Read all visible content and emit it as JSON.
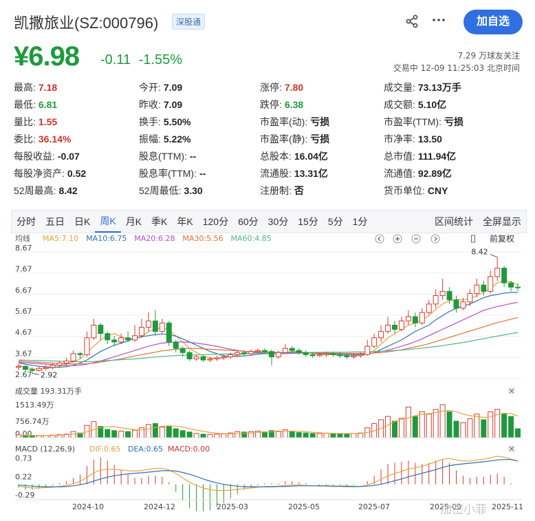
{
  "header": {
    "title": "凯撒旅业(SZ:000796)",
    "tag": "深股通",
    "follow_button": "加自选",
    "share_icon": "share-icon",
    "more_icon": "more-icon"
  },
  "quote": {
    "price": "¥6.98",
    "change": "-0.11",
    "change_pct": "-1.55%",
    "followers": "7.29 万球友关注",
    "status_time": "交易中 12-09 11:25:03 北京时间",
    "price_color": "#1d9a3c"
  },
  "stats": [
    {
      "k": "最高:",
      "v": "7.18",
      "c": "red"
    },
    {
      "k": "今开:",
      "v": "7.09",
      "c": "dark"
    },
    {
      "k": "涨停:",
      "v": "7.80",
      "c": "red"
    },
    {
      "k": "成交量:",
      "v": "73.13万手",
      "c": "dark"
    },
    {
      "k": "最低:",
      "v": "6.81",
      "c": "green"
    },
    {
      "k": "昨收:",
      "v": "7.09",
      "c": "dark"
    },
    {
      "k": "跌停:",
      "v": "6.38",
      "c": "green"
    },
    {
      "k": "成交额:",
      "v": "5.10亿",
      "c": "dark"
    },
    {
      "k": "量比:",
      "v": "1.55",
      "c": "red"
    },
    {
      "k": "换手:",
      "v": "5.50%",
      "c": "dark"
    },
    {
      "k": "市盈率(动):",
      "v": "亏损",
      "c": "dark"
    },
    {
      "k": "市盈率(TTM):",
      "v": "亏损",
      "c": "dark"
    },
    {
      "k": "委比:",
      "v": "36.14%",
      "c": "red"
    },
    {
      "k": "振幅:",
      "v": "5.22%",
      "c": "dark"
    },
    {
      "k": "市盈率(静):",
      "v": "亏损",
      "c": "dark"
    },
    {
      "k": "市净率:",
      "v": "13.50",
      "c": "dark"
    },
    {
      "k": "每股收益:",
      "v": "-0.07",
      "c": "dark"
    },
    {
      "k": "股息(TTM):",
      "v": "--",
      "c": "dark"
    },
    {
      "k": "总股本:",
      "v": "16.04亿",
      "c": "dark"
    },
    {
      "k": "总市值:",
      "v": "111.94亿",
      "c": "dark"
    },
    {
      "k": "每股净资产:",
      "v": "0.52",
      "c": "dark"
    },
    {
      "k": "股息率(TTM):",
      "v": "--",
      "c": "dark"
    },
    {
      "k": "流通股:",
      "v": "13.31亿",
      "c": "dark"
    },
    {
      "k": "流通值:",
      "v": "92.89亿",
      "c": "dark"
    },
    {
      "k": "52周最高:",
      "v": "8.42",
      "c": "dark"
    },
    {
      "k": "52周最低:",
      "v": "3.30",
      "c": "dark"
    },
    {
      "k": "注册制:",
      "v": "否",
      "c": "dark"
    },
    {
      "k": "货币单位:",
      "v": "CNY",
      "c": "dark"
    }
  ],
  "tabs": [
    "分时",
    "五日",
    "日K",
    "周K",
    "月K",
    "季K",
    "年K",
    "120分",
    "60分",
    "30分",
    "15分",
    "5分",
    "1分"
  ],
  "active_tab": "周K",
  "tabs_right": [
    "区间统计",
    "全屏显示"
  ],
  "chart_data": {
    "type": "candlestick",
    "kline": {
      "label": "均线",
      "ma_labels": [
        {
          "text": "MA5:7.10",
          "color": "#e6a23c"
        },
        {
          "text": "MA10:6.75",
          "color": "#2f6fb0"
        },
        {
          "text": "MA20:6.28",
          "color": "#b44fc6"
        },
        {
          "text": "MA30:5.56",
          "color": "#e0703a"
        },
        {
          "text": "MA60:4.85",
          "color": "#4fb58a"
        }
      ],
      "y_ticks": [
        "8.67",
        "7.67",
        "6.67",
        "5.67",
        "4.67",
        "3.67",
        "2.67"
      ],
      "ylim": [
        2.67,
        8.67
      ],
      "max_label": "8.42",
      "min_label": "2.92",
      "fq_label": "前复权",
      "toolbar_icons": [
        "chevron-left-icon",
        "plus-icon",
        "minus-icon",
        "chevron-right-icon",
        "candle-icon"
      ]
    },
    "candles": [
      [
        3.2,
        3.25,
        3.05,
        3.35
      ],
      [
        3.25,
        3.1,
        3.0,
        3.3
      ],
      [
        3.1,
        3.05,
        2.92,
        3.2
      ],
      [
        3.05,
        3.15,
        3.0,
        3.25
      ],
      [
        3.15,
        3.2,
        3.05,
        3.3
      ],
      [
        3.2,
        3.3,
        3.1,
        3.4
      ],
      [
        3.3,
        3.4,
        3.2,
        3.5
      ],
      [
        3.4,
        3.5,
        3.3,
        3.65
      ],
      [
        3.5,
        3.85,
        3.45,
        4.0
      ],
      [
        3.85,
        3.8,
        3.6,
        3.95
      ],
      [
        3.8,
        4.6,
        3.7,
        4.9
      ],
      [
        4.6,
        5.2,
        4.5,
        5.5
      ],
      [
        5.2,
        4.8,
        4.5,
        5.3
      ],
      [
        4.8,
        4.5,
        4.3,
        4.9
      ],
      [
        4.5,
        4.4,
        4.2,
        4.7
      ],
      [
        4.4,
        4.6,
        4.3,
        4.8
      ],
      [
        4.6,
        4.5,
        4.4,
        4.9
      ],
      [
        4.5,
        4.7,
        4.4,
        5.2
      ],
      [
        4.7,
        5.1,
        4.6,
        5.5
      ],
      [
        5.1,
        5.4,
        4.9,
        5.8
      ],
      [
        5.4,
        4.9,
        4.7,
        5.9
      ],
      [
        4.9,
        5.3,
        4.8,
        5.5
      ],
      [
        5.3,
        4.4,
        4.2,
        5.4
      ],
      [
        4.4,
        4.1,
        3.9,
        4.5
      ],
      [
        4.1,
        3.9,
        3.7,
        4.2
      ],
      [
        3.9,
        3.6,
        3.5,
        4.0
      ],
      [
        3.6,
        3.7,
        3.5,
        3.8
      ],
      [
        3.7,
        3.55,
        3.45,
        3.75
      ],
      [
        3.55,
        3.6,
        3.45,
        3.7
      ],
      [
        3.6,
        3.65,
        3.5,
        3.75
      ],
      [
        3.65,
        3.7,
        3.55,
        3.8
      ],
      [
        3.7,
        3.8,
        3.6,
        3.9
      ],
      [
        3.8,
        3.9,
        3.7,
        4.0
      ],
      [
        3.9,
        3.85,
        3.75,
        4.0
      ],
      [
        3.85,
        3.95,
        3.8,
        4.05
      ],
      [
        3.95,
        4.0,
        3.85,
        4.1
      ],
      [
        4.0,
        3.95,
        3.85,
        4.1
      ],
      [
        3.95,
        3.7,
        3.3,
        4.05
      ],
      [
        3.7,
        3.9,
        3.6,
        4.0
      ],
      [
        3.9,
        4.1,
        3.85,
        4.3
      ],
      [
        4.1,
        4.0,
        3.9,
        4.2
      ],
      [
        4.0,
        3.9,
        3.8,
        4.1
      ],
      [
        3.9,
        3.8,
        3.7,
        4.0
      ],
      [
        3.8,
        3.75,
        3.65,
        3.9
      ],
      [
        3.75,
        3.8,
        3.7,
        3.9
      ],
      [
        3.8,
        3.85,
        3.7,
        3.95
      ],
      [
        3.85,
        3.8,
        3.7,
        3.95
      ],
      [
        3.8,
        3.75,
        3.65,
        3.9
      ],
      [
        3.75,
        3.7,
        3.6,
        3.85
      ],
      [
        3.7,
        3.75,
        3.6,
        3.85
      ],
      [
        3.75,
        3.8,
        3.65,
        3.9
      ],
      [
        3.8,
        4.2,
        3.75,
        4.5
      ],
      [
        4.2,
        4.6,
        4.1,
        4.8
      ],
      [
        4.6,
        4.9,
        4.4,
        5.2
      ],
      [
        4.9,
        5.2,
        4.8,
        5.6
      ],
      [
        5.2,
        5.0,
        4.8,
        5.4
      ],
      [
        5.0,
        5.4,
        4.9,
        5.6
      ],
      [
        5.4,
        5.6,
        5.2,
        5.9
      ],
      [
        5.6,
        5.3,
        5.1,
        5.8
      ],
      [
        5.3,
        5.8,
        5.2,
        6.0
      ],
      [
        5.8,
        6.2,
        5.7,
        6.4
      ],
      [
        6.2,
        6.6,
        6.0,
        6.9
      ],
      [
        6.6,
        6.8,
        6.4,
        7.4
      ],
      [
        6.8,
        6.4,
        6.2,
        7.0
      ],
      [
        6.4,
        6.0,
        5.8,
        6.6
      ],
      [
        6.0,
        6.3,
        5.9,
        6.5
      ],
      [
        6.3,
        6.7,
        6.1,
        6.9
      ],
      [
        6.7,
        7.1,
        6.5,
        7.4
      ],
      [
        7.1,
        6.8,
        6.6,
        7.3
      ],
      [
        6.8,
        7.5,
        6.7,
        7.8
      ],
      [
        7.5,
        7.9,
        7.3,
        8.42
      ],
      [
        7.9,
        7.2,
        7.0,
        8.0
      ],
      [
        7.2,
        7.0,
        6.8,
        7.3
      ],
      [
        7.0,
        6.98,
        6.81,
        7.18
      ]
    ],
    "ma_series": [
      {
        "name": "MA5",
        "color": "#e6a23c",
        "values": [
          3.3,
          3.2,
          3.12,
          3.12,
          3.15,
          3.18,
          3.25,
          3.35,
          3.45,
          3.6,
          3.9,
          4.2,
          4.5,
          4.7,
          4.8,
          4.65,
          4.55,
          4.55,
          4.65,
          4.9,
          5.0,
          5.1,
          4.95,
          4.7,
          4.4,
          4.1,
          3.9,
          3.75,
          3.65,
          3.6,
          3.65,
          3.7,
          3.78,
          3.82,
          3.87,
          3.92,
          3.95,
          3.88,
          3.85,
          3.9,
          3.95,
          3.95,
          3.9,
          3.85,
          3.82,
          3.8,
          3.8,
          3.78,
          3.76,
          3.75,
          3.76,
          3.85,
          4.0,
          4.3,
          4.6,
          4.8,
          5.0,
          5.2,
          5.3,
          5.45,
          5.65,
          5.95,
          6.2,
          6.35,
          6.4,
          6.4,
          6.45,
          6.6,
          6.75,
          6.95,
          7.2,
          7.3,
          7.25,
          7.1
        ]
      },
      {
        "name": "MA10",
        "color": "#2f6fb0",
        "values": [
          3.4,
          3.35,
          3.3,
          3.25,
          3.22,
          3.2,
          3.2,
          3.23,
          3.3,
          3.4,
          3.55,
          3.75,
          3.95,
          4.1,
          4.25,
          4.35,
          4.45,
          4.6,
          4.65,
          4.7,
          4.75,
          4.78,
          4.75,
          4.68,
          4.55,
          4.4,
          4.25,
          4.1,
          3.95,
          3.85,
          3.75,
          3.72,
          3.72,
          3.74,
          3.78,
          3.82,
          3.85,
          3.85,
          3.87,
          3.9,
          3.92,
          3.92,
          3.9,
          3.88,
          3.86,
          3.84,
          3.82,
          3.8,
          3.8,
          3.8,
          3.8,
          3.82,
          3.9,
          4.05,
          4.2,
          4.35,
          4.5,
          4.7,
          4.9,
          5.05,
          5.2,
          5.45,
          5.65,
          5.85,
          6.0,
          6.1,
          6.2,
          6.35,
          6.5,
          6.6,
          6.65,
          6.72,
          6.75,
          6.75
        ]
      },
      {
        "name": "MA20",
        "color": "#b44fc6",
        "values": [
          3.45,
          3.42,
          3.4,
          3.37,
          3.35,
          3.32,
          3.3,
          3.28,
          3.28,
          3.3,
          3.35,
          3.42,
          3.5,
          3.6,
          3.7,
          3.8,
          3.9,
          4.0,
          4.1,
          4.2,
          4.28,
          4.35,
          4.38,
          4.4,
          4.4,
          4.38,
          4.35,
          4.3,
          4.25,
          4.2,
          4.12,
          4.06,
          4.0,
          3.96,
          3.93,
          3.9,
          3.88,
          3.86,
          3.85,
          3.85,
          3.86,
          3.87,
          3.88,
          3.88,
          3.87,
          3.86,
          3.86,
          3.85,
          3.85,
          3.85,
          3.85,
          3.86,
          3.88,
          3.95,
          4.02,
          4.1,
          4.2,
          4.3,
          4.42,
          4.55,
          4.7,
          4.85,
          5.0,
          5.15,
          5.3,
          5.45,
          5.6,
          5.75,
          5.9,
          6.0,
          6.08,
          6.15,
          6.22,
          6.28
        ]
      },
      {
        "name": "MA30",
        "color": "#e0703a",
        "values": [
          3.5,
          3.48,
          3.46,
          3.44,
          3.42,
          3.4,
          3.38,
          3.37,
          3.36,
          3.36,
          3.37,
          3.4,
          3.45,
          3.5,
          3.55,
          3.6,
          3.67,
          3.74,
          3.8,
          3.86,
          3.92,
          3.98,
          4.02,
          4.06,
          4.08,
          4.1,
          4.1,
          4.08,
          4.06,
          4.04,
          4.02,
          4.0,
          3.98,
          3.96,
          3.95,
          3.94,
          3.93,
          3.92,
          3.91,
          3.9,
          3.9,
          3.89,
          3.89,
          3.88,
          3.88,
          3.87,
          3.87,
          3.87,
          3.86,
          3.86,
          3.86,
          3.87,
          3.88,
          3.9,
          3.94,
          3.98,
          4.03,
          4.1,
          4.17,
          4.24,
          4.32,
          4.42,
          4.52,
          4.62,
          4.72,
          4.82,
          4.92,
          5.02,
          5.12,
          5.22,
          5.32,
          5.4,
          5.48,
          5.56
        ]
      },
      {
        "name": "MA60",
        "color": "#4fb58a",
        "values": [
          3.55,
          3.54,
          3.53,
          3.52,
          3.51,
          3.5,
          3.49,
          3.48,
          3.47,
          3.47,
          3.47,
          3.48,
          3.5,
          3.52,
          3.54,
          3.56,
          3.58,
          3.6,
          3.63,
          3.66,
          3.69,
          3.72,
          3.74,
          3.76,
          3.77,
          3.78,
          3.79,
          3.8,
          3.81,
          3.82,
          3.83,
          3.84,
          3.85,
          3.86,
          3.87,
          3.87,
          3.88,
          3.88,
          3.89,
          3.89,
          3.9,
          3.9,
          3.9,
          3.91,
          3.91,
          3.91,
          3.92,
          3.92,
          3.92,
          3.93,
          3.93,
          3.94,
          3.95,
          3.96,
          3.98,
          4.0,
          4.02,
          4.05,
          4.08,
          4.11,
          4.15,
          4.19,
          4.23,
          4.28,
          4.33,
          4.38,
          4.43,
          4.5,
          4.56,
          4.62,
          4.68,
          4.74,
          4.8,
          4.85
        ]
      }
    ],
    "volume": {
      "label": "成交量 193.31万手",
      "y_ticks": [
        "1513.49万",
        "756.74万",
        "0.00"
      ],
      "max": 1513.49,
      "values": [
        120,
        90,
        80,
        85,
        95,
        110,
        130,
        150,
        260,
        200,
        520,
        680,
        480,
        350,
        300,
        280,
        260,
        320,
        420,
        560,
        600,
        450,
        500,
        380,
        300,
        240,
        180,
        150,
        140,
        150,
        160,
        200,
        260,
        240,
        260,
        280,
        250,
        300,
        280,
        340,
        260,
        220,
        200,
        180,
        180,
        190,
        180,
        170,
        170,
        180,
        200,
        420,
        600,
        760,
        900,
        700,
        820,
        1300,
        900,
        1100,
        1000,
        1200,
        1400,
        1100,
        700,
        640,
        800,
        1000,
        760,
        1100,
        1200,
        1000,
        900,
        380
      ],
      "ma_values": [
        110,
        105,
        100,
        95,
        95,
        100,
        110,
        125,
        150,
        175,
        250,
        350,
        430,
        460,
        470,
        420,
        380,
        340,
        330,
        370,
        430,
        480,
        500,
        490,
        450,
        380,
        320,
        270,
        220,
        190,
        170,
        170,
        180,
        190,
        200,
        220,
        240,
        250,
        260,
        270,
        280,
        270,
        250,
        230,
        210,
        195,
        185,
        180,
        175,
        175,
        180,
        220,
        290,
        400,
        530,
        680,
        780,
        840,
        930,
        1000,
        1020,
        1060,
        1120,
        1160,
        1100,
        1000,
        930,
        900,
        860,
        880,
        980,
        1040,
        1020,
        920
      ],
      "ma_color": "#e6a23c"
    },
    "macd": {
      "label": "MACD (12,26,9)",
      "dif_label": "DIF:0.65",
      "dea_label": "DEA:0.65",
      "macd_label": "MACD:0.00",
      "y_ticks": [
        "0.73",
        "0.22",
        "-0.29"
      ],
      "ylim": [
        -0.35,
        0.8
      ],
      "dif": [
        -0.05,
        -0.08,
        -0.1,
        -0.1,
        -0.09,
        -0.08,
        -0.06,
        -0.03,
        0.02,
        0.08,
        0.2,
        0.32,
        0.4,
        0.42,
        0.42,
        0.4,
        0.38,
        0.37,
        0.38,
        0.42,
        0.44,
        0.45,
        0.4,
        0.3,
        0.18,
        0.06,
        -0.03,
        -0.1,
        -0.15,
        -0.17,
        -0.17,
        -0.16,
        -0.14,
        -0.12,
        -0.1,
        -0.08,
        -0.06,
        -0.06,
        -0.05,
        -0.03,
        -0.02,
        -0.02,
        -0.03,
        -0.04,
        -0.05,
        -0.05,
        -0.06,
        -0.06,
        -0.07,
        -0.07,
        -0.06,
        -0.02,
        0.05,
        0.14,
        0.24,
        0.3,
        0.36,
        0.43,
        0.46,
        0.5,
        0.56,
        0.63,
        0.7,
        0.72,
        0.68,
        0.65,
        0.65,
        0.68,
        0.7,
        0.74,
        0.78,
        0.76,
        0.7,
        0.65
      ],
      "dea": [
        -0.02,
        -0.03,
        -0.05,
        -0.06,
        -0.07,
        -0.07,
        -0.07,
        -0.06,
        -0.04,
        -0.01,
        0.03,
        0.09,
        0.15,
        0.2,
        0.24,
        0.27,
        0.29,
        0.31,
        0.32,
        0.34,
        0.36,
        0.38,
        0.38,
        0.37,
        0.33,
        0.28,
        0.22,
        0.15,
        0.09,
        0.04,
        0.0,
        -0.03,
        -0.05,
        -0.07,
        -0.07,
        -0.07,
        -0.07,
        -0.07,
        -0.06,
        -0.06,
        -0.05,
        -0.04,
        -0.04,
        -0.04,
        -0.04,
        -0.04,
        -0.05,
        -0.05,
        -0.05,
        -0.06,
        -0.06,
        -0.05,
        -0.03,
        0.0,
        0.05,
        0.1,
        0.15,
        0.21,
        0.26,
        0.31,
        0.36,
        0.41,
        0.47,
        0.52,
        0.55,
        0.57,
        0.59,
        0.61,
        0.63,
        0.65,
        0.68,
        0.69,
        0.69,
        0.65
      ],
      "dif_color": "#e6a23c",
      "dea_color": "#2f6fb0"
    },
    "x_labels": [
      "2024-10",
      "2024-12",
      "2025-03",
      "2025-05",
      "2025-07",
      "2025-09",
      "2025-11"
    ],
    "x_label_index": [
      9,
      18,
      27,
      36,
      45,
      54,
      63,
      72
    ],
    "watermark": "加密小菲"
  }
}
